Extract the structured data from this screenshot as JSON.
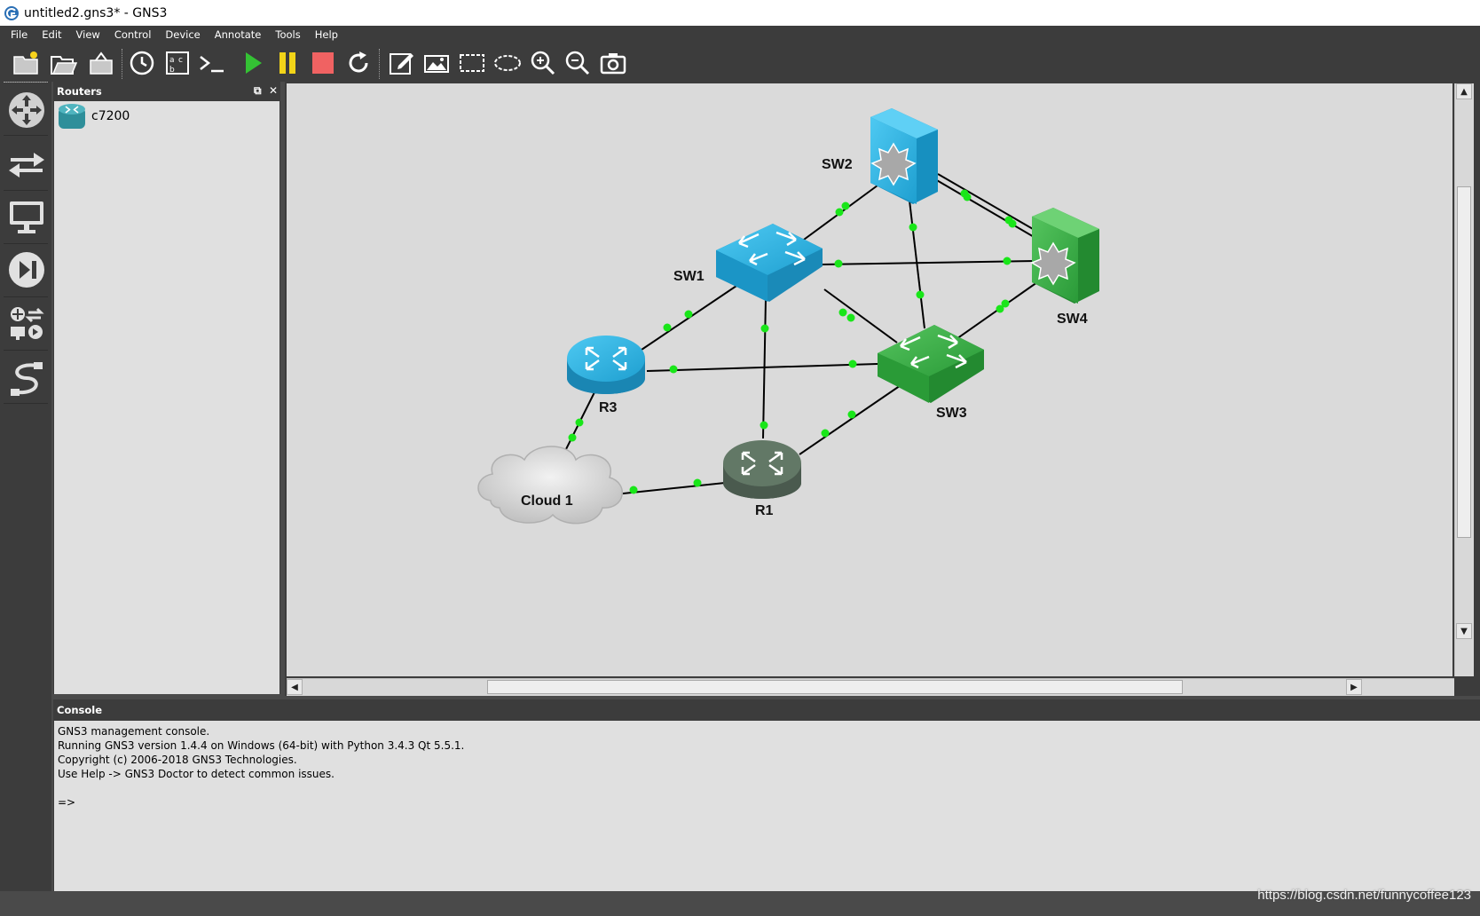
{
  "window": {
    "title": "untitled2.gns3* - GNS3"
  },
  "menu": [
    "File",
    "Edit",
    "View",
    "Control",
    "Device",
    "Annotate",
    "Tools",
    "Help"
  ],
  "toolbar": {
    "icons": [
      "new-project-icon",
      "open-project-icon",
      "snapshot-icon",
      "history-icon",
      "show-interface-labels-icon",
      "console-all-icon",
      "start-all-icon",
      "suspend-all-icon",
      "stop-all-icon",
      "reload-all-icon",
      "add-note-icon",
      "insert-image-icon",
      "draw-rectangle-icon",
      "draw-ellipse-icon",
      "zoom-in-icon",
      "zoom-out-icon",
      "screenshot-icon"
    ]
  },
  "left_toolbar": {
    "icons": [
      "routers-category-icon",
      "switches-category-icon",
      "end-devices-category-icon",
      "security-devices-category-icon",
      "all-devices-icon",
      "add-link-icon"
    ]
  },
  "routers_panel": {
    "title": "Routers",
    "items": [
      {
        "label": "c7200",
        "icon": "router-c7200-icon"
      }
    ]
  },
  "topology": {
    "nodes": [
      {
        "id": "SW2",
        "label": "SW2",
        "kind": "multilayer-switch",
        "color": "#1aa5d6"
      },
      {
        "id": "SW1",
        "label": "SW1",
        "kind": "switch",
        "color": "#1aa5d6"
      },
      {
        "id": "SW4",
        "label": "SW4",
        "kind": "multilayer-switch",
        "color": "#2e9e3e"
      },
      {
        "id": "SW3",
        "label": "SW3",
        "kind": "switch",
        "color": "#2e9e3e"
      },
      {
        "id": "R3",
        "label": "R3",
        "kind": "router",
        "color": "#1aa5d6"
      },
      {
        "id": "R1",
        "label": "R1",
        "kind": "router",
        "color": "#5a6e5e"
      },
      {
        "id": "Cloud1",
        "label": "Cloud 1",
        "kind": "cloud",
        "color": "#d0d0d0"
      }
    ],
    "links": [
      [
        "SW2",
        "SW1"
      ],
      [
        "SW2",
        "SW4"
      ],
      [
        "SW2",
        "SW3"
      ],
      [
        "SW1",
        "SW4"
      ],
      [
        "SW1",
        "SW3"
      ],
      [
        "SW1",
        "R3"
      ],
      [
        "SW1",
        "R1"
      ],
      [
        "R3",
        "SW3"
      ],
      [
        "R3",
        "Cloud1"
      ],
      [
        "Cloud1",
        "R1"
      ],
      [
        "R1",
        "SW3"
      ],
      [
        "SW3",
        "SW4"
      ]
    ],
    "link_status_color": "#19e619"
  },
  "console": {
    "title": "Console",
    "lines": [
      "GNS3 management console.",
      "Running GNS3 version 1.4.4 on Windows (64-bit) with Python 3.4.3 Qt 5.5.1.",
      "Copyright (c) 2006-2018 GNS3 Technologies.",
      "Use Help -> GNS3 Doctor to detect common issues.",
      "",
      "=>"
    ]
  },
  "watermark": "https://blog.csdn.net/funnycoffee123"
}
